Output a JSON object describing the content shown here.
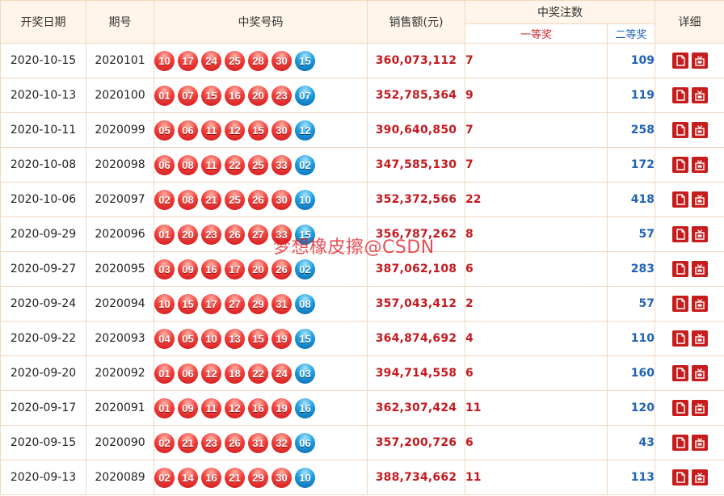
{
  "header": {
    "date": "开奖日期",
    "issue": "期号",
    "numbers": "中奖号码",
    "sales": "销售额(元)",
    "winners": "中奖注数",
    "first": "一等奖",
    "second": "二等奖",
    "detail": "详细"
  },
  "watermark": "梦想橡皮擦@CSDN",
  "colors": {
    "red_ball": "#e8262a",
    "blue_ball": "#1b8fd6",
    "accent_red": "#c4191f",
    "accent_blue": "#1f63b6"
  },
  "icons": {
    "doc": "document-icon",
    "tv": "tv-icon"
  },
  "rows": [
    {
      "date": "2020-10-15",
      "issue": "2020101",
      "red": [
        "10",
        "17",
        "24",
        "25",
        "28",
        "30"
      ],
      "blue": "15",
      "sales": "360,073,112",
      "first": "7",
      "second": "109"
    },
    {
      "date": "2020-10-13",
      "issue": "2020100",
      "red": [
        "01",
        "07",
        "15",
        "16",
        "20",
        "23"
      ],
      "blue": "07",
      "sales": "352,785,364",
      "first": "9",
      "second": "119"
    },
    {
      "date": "2020-10-11",
      "issue": "2020099",
      "red": [
        "05",
        "06",
        "11",
        "12",
        "15",
        "30"
      ],
      "blue": "12",
      "sales": "390,640,850",
      "first": "7",
      "second": "258"
    },
    {
      "date": "2020-10-08",
      "issue": "2020098",
      "red": [
        "06",
        "08",
        "11",
        "22",
        "25",
        "33"
      ],
      "blue": "02",
      "sales": "347,585,130",
      "first": "7",
      "second": "172"
    },
    {
      "date": "2020-10-06",
      "issue": "2020097",
      "red": [
        "02",
        "08",
        "21",
        "25",
        "26",
        "30"
      ],
      "blue": "10",
      "sales": "352,372,566",
      "first": "22",
      "second": "418"
    },
    {
      "date": "2020-09-29",
      "issue": "2020096",
      "red": [
        "01",
        "20",
        "23",
        "26",
        "27",
        "33"
      ],
      "blue": "15",
      "sales": "356,787,262",
      "first": "8",
      "second": "57"
    },
    {
      "date": "2020-09-27",
      "issue": "2020095",
      "red": [
        "03",
        "09",
        "16",
        "17",
        "20",
        "26"
      ],
      "blue": "02",
      "sales": "387,062,108",
      "first": "6",
      "second": "283"
    },
    {
      "date": "2020-09-24",
      "issue": "2020094",
      "red": [
        "10",
        "15",
        "17",
        "27",
        "29",
        "31"
      ],
      "blue": "08",
      "sales": "357,043,412",
      "first": "2",
      "second": "57"
    },
    {
      "date": "2020-09-22",
      "issue": "2020093",
      "red": [
        "04",
        "05",
        "10",
        "13",
        "15",
        "19"
      ],
      "blue": "15",
      "sales": "364,874,692",
      "first": "4",
      "second": "110"
    },
    {
      "date": "2020-09-20",
      "issue": "2020092",
      "red": [
        "01",
        "06",
        "12",
        "18",
        "22",
        "24"
      ],
      "blue": "03",
      "sales": "394,714,558",
      "first": "6",
      "second": "160"
    },
    {
      "date": "2020-09-17",
      "issue": "2020091",
      "red": [
        "01",
        "09",
        "11",
        "12",
        "16",
        "19"
      ],
      "blue": "16",
      "sales": "362,307,424",
      "first": "11",
      "second": "120"
    },
    {
      "date": "2020-09-15",
      "issue": "2020090",
      "red": [
        "02",
        "21",
        "23",
        "26",
        "31",
        "32"
      ],
      "blue": "06",
      "sales": "357,200,726",
      "first": "6",
      "second": "43"
    },
    {
      "date": "2020-09-13",
      "issue": "2020089",
      "red": [
        "02",
        "14",
        "16",
        "21",
        "29",
        "30"
      ],
      "blue": "10",
      "sales": "388,734,662",
      "first": "11",
      "second": "113"
    }
  ]
}
